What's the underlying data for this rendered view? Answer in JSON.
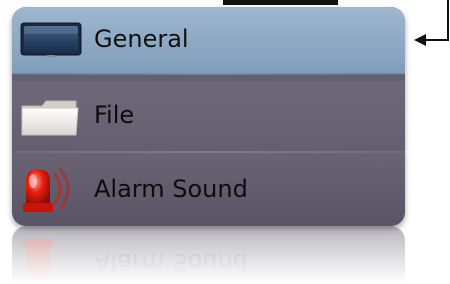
{
  "menu": {
    "items": [
      {
        "label": "General",
        "icon": "monitor-icon",
        "selected": true
      },
      {
        "label": "File",
        "icon": "folder-icon",
        "selected": false
      },
      {
        "label": "Alarm Sound",
        "icon": "siren-icon",
        "selected": false
      }
    ]
  },
  "reflection": {
    "label": "Alarm Sound"
  },
  "colors": {
    "selected_bg": "#8ba6c3",
    "panel_bg": "#625c6e",
    "arrow": "#111111"
  }
}
